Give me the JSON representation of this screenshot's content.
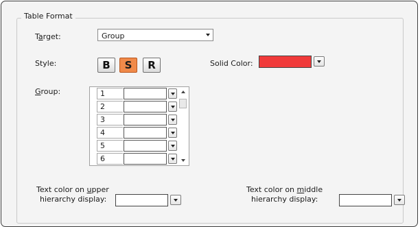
{
  "group_title": "Table Format",
  "target": {
    "label_pre": "T",
    "label_ul": "a",
    "label_post": "rget:",
    "value": "Group"
  },
  "style": {
    "label": "Style:",
    "buttons": [
      {
        "label": "B",
        "active": false
      },
      {
        "label": "S",
        "active": true
      },
      {
        "label": "R",
        "active": false
      }
    ]
  },
  "solid_color": {
    "label": "Solid Color:",
    "color": "#f03a3a"
  },
  "group": {
    "label_ul": "G",
    "label_post": "roup:",
    "rows": [
      {
        "num": "1"
      },
      {
        "num": "2"
      },
      {
        "num": "3"
      },
      {
        "num": "4"
      },
      {
        "num": "5"
      },
      {
        "num": "6"
      }
    ]
  },
  "upper": {
    "line1_pre": "Text color on ",
    "line1_ul": "u",
    "line1_post": "pper",
    "line2": "hierarchy display:"
  },
  "middle": {
    "line1_pre": "Text color on ",
    "line1_ul": "m",
    "line1_post": "iddle",
    "line2": "hierarchy display:"
  }
}
